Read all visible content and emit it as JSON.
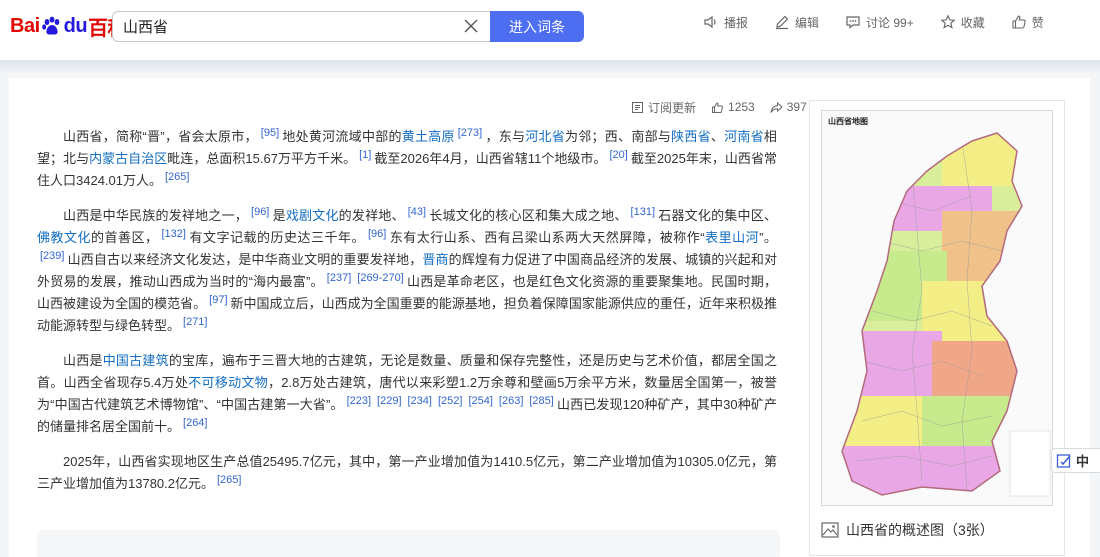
{
  "header": {
    "logo": {
      "bai": "Bai",
      "du": "du",
      "baike": "百科"
    },
    "search": {
      "value": "山西省",
      "button_label": "进入词条"
    },
    "tools": [
      {
        "label": "播报",
        "icon": "speaker-icon"
      },
      {
        "label": "编辑",
        "icon": "pencil-icon"
      },
      {
        "label": "讨论 99+",
        "icon": "chat-icon"
      },
      {
        "label": "收藏",
        "icon": "star-icon"
      },
      {
        "label": "赞",
        "icon": "thumbs-up-icon"
      }
    ]
  },
  "meta": {
    "subscribe_label": "订阅更新",
    "like_count": "1253",
    "share_count": "397"
  },
  "article": {
    "p1": {
      "t1": "山西省，简称“晋”，省会太原市，",
      "r1": "[95]",
      "t2": "地处黄河流域中部的",
      "l1": "黄土高原",
      "r2": "[273]",
      "t3": "，东与",
      "l2": "河北省",
      "t4": "为邻；西、南部与",
      "l3": "陕西省",
      "t5": "、",
      "l4": "河南省",
      "t6": "相望；北与",
      "l5": "内蒙古自治区",
      "t7": "毗连，总面积15.67万平方千米。",
      "r3": "[1]",
      "t8": "截至2026年4月，山西省辖11个地级市。",
      "r4": "[20]",
      "t9": "截至2025年末，山西省常住人口3424.01万人。",
      "r5": "[265]"
    },
    "p2": {
      "t1": "山西是中华民族的发祥地之一，",
      "r1": "[96]",
      "t2": "是",
      "l1": "戏剧文化",
      "t3": "的发祥地、",
      "r2": "[43]",
      "t4": "长城文化的核心区和集大成之地、",
      "r3": "[131]",
      "t5": "石器文化的集中区、",
      "l2": "佛教文化",
      "t6": "的首善区，",
      "r4": "[132]",
      "t7": "有文字记载的历史达三千年。",
      "r5": "[96]",
      "t8": "东有太行山系、西有吕梁山系两大天然屏障，被称作“",
      "l3": "表里山河",
      "t9": "”。",
      "r6": "[239]",
      "t10": "山西自古以来经济文化发达，是中华商业文明的重要发祥地，",
      "l4": "晋商",
      "t11": "的辉煌有力促进了中国商品经济的发展、城镇的兴起和对外贸易的发展，推动山西成为当时的“海内最富”。",
      "r7": "[237]",
      "r8": "[269-270]",
      "t12": "山西是革命老区，也是红色文化资源的重要聚集地。民国时期，山西被建设为全国的模范省。",
      "r9": "[97]",
      "t13": "新中国成立后，山西成为全国重要的能源基地，担负着保障国家能源供应的重任，近年来积极推动能源转型与绿色转型。",
      "r10": "[271]"
    },
    "p3": {
      "t1": "山西是",
      "l1": "中国古建筑",
      "t2": "的宝库，遍布于三晋大地的古建筑，无论是数量、质量和保存完整性，还是历史与艺术价值，都居全国之首。山西全省现存5.4万处",
      "l2": "不可移动文物",
      "t3": "，2.8万处古建筑，唐代以来彩塑1.2万余尊和壁画5万余平方米，数量居全国第一，被誉为“中国古代建筑艺术博物馆”、“中国古建第一大省”。",
      "r1": "[223]",
      "r2": "[229]",
      "r3": "[234]",
      "r4": "[252]",
      "r5": "[254]",
      "r6": "[263]",
      "r7": "[285]",
      "t4": "山西已发现120种矿产，其中30种矿产的储量排名居全国前十。",
      "r8": "[264]"
    },
    "p4": {
      "t1": "2025年，山西省实现地区生产总值25495.7亿元，其中，第一产业增加值为1410.5亿元，第二产业增加值为10305.0亿元，第三产业增加值为13780.2亿元。",
      "r1": "[265]"
    }
  },
  "map_card": {
    "map_title": "山西省地图",
    "caption": "山西省的概述图（3张）"
  },
  "side_button": {
    "label": "中"
  },
  "colors": {
    "accent_blue": "#4e6ef2",
    "link_blue": "#136ec2",
    "brand_red": "#e10601",
    "brand_blue": "#2319dc"
  }
}
